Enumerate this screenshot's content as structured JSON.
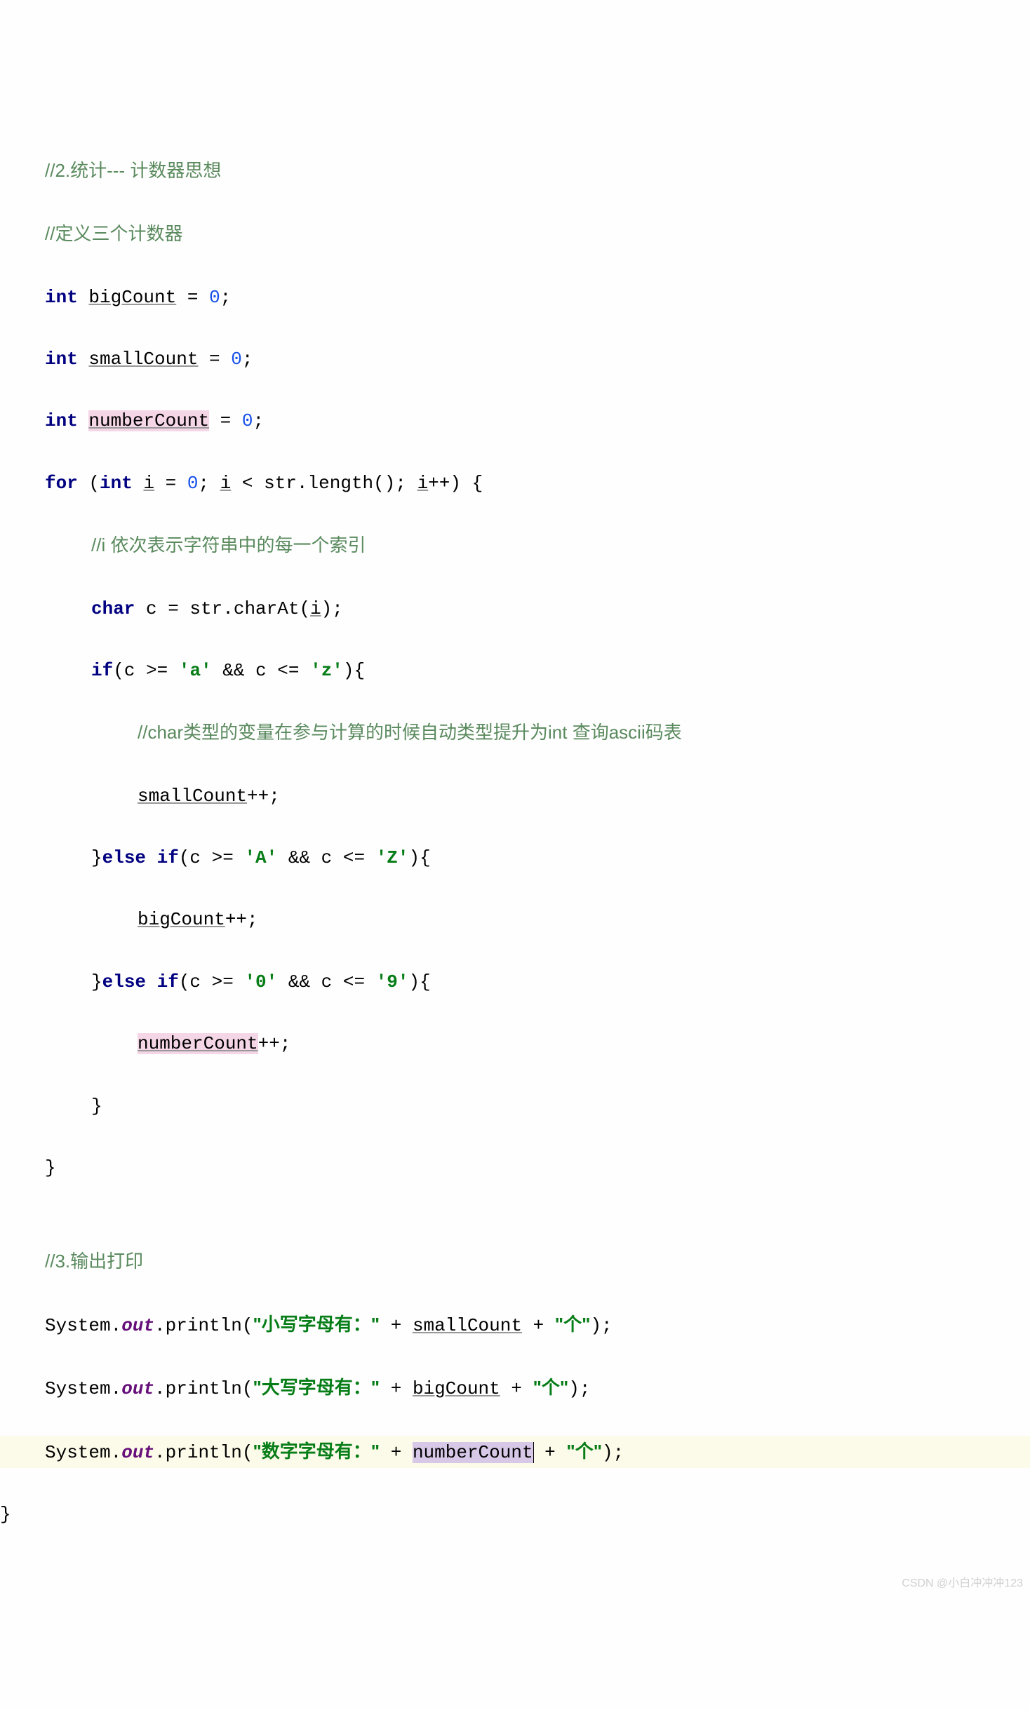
{
  "code": {
    "l1": {
      "c1": "//2.统计--- 计数器思想"
    },
    "l2": {
      "c1": "//定义三个计数器"
    },
    "l3": {
      "kw": "int",
      "var": "bigCount",
      "op": " = ",
      "num": "0",
      "semi": ";"
    },
    "l4": {
      "kw": "int",
      "var": "smallCount",
      "op": " = ",
      "num": "0",
      "semi": ";"
    },
    "l5": {
      "kw": "int",
      "var": "numberCount",
      "op": " = ",
      "num": "0",
      "semi": ";"
    },
    "l6": {
      "kw1": "for",
      "p1": " (",
      "kw2": "int",
      "v1": "i",
      "eq": " = ",
      "n1": "0",
      "s1": "; ",
      "v2": "i",
      "cmp": " < ",
      "obj": "str.length(); ",
      "v3": "i",
      "inc": "++) {"
    },
    "l7": {
      "c1": "//i 依次表示字符串中的每一个索引"
    },
    "l8": {
      "kw": "char",
      "txt1": " c = str.charAt(",
      "var": "i",
      "txt2": ");"
    },
    "l9": {
      "kw": "if",
      "p1": "(c >= ",
      "ch1": "'a'",
      "op1": " && c <= ",
      "ch2": "'z'",
      "p2": "){"
    },
    "l10": {
      "c1": "//char类型的变量在参与计算的时候自动类型提升为int 查询ascii码表"
    },
    "l11": {
      "var": "smallCount",
      "inc": "++;"
    },
    "l12": {
      "p1": "}",
      "kw": "else if",
      "p2": "(c >= ",
      "ch1": "'A'",
      "op1": " && c <= ",
      "ch2": "'Z'",
      "p3": "){"
    },
    "l13": {
      "var": "bigCount",
      "inc": "++;"
    },
    "l14": {
      "p1": "}",
      "kw": "else if",
      "p2": "(c >= ",
      "ch1": "'0'",
      "op1": " && c <= ",
      "ch2": "'9'",
      "p3": "){"
    },
    "l15": {
      "var": "numberCount",
      "inc": "++;"
    },
    "l16": {
      "brace": "}"
    },
    "l17": {
      "brace": "}"
    },
    "l18": {
      "blank": ""
    },
    "l19": {
      "c1": "//3.输出打印"
    },
    "l20": {
      "sys": "System.",
      "out": "out",
      "pr": ".println(",
      "str": "\"小写字母有：\"",
      "op1": " + ",
      "var": "smallCount",
      "op2": " + ",
      "str2": "\"个\"",
      "end": ");"
    },
    "l21": {
      "sys": "System.",
      "out": "out",
      "pr": ".println(",
      "str": "\"大写字母有：\"",
      "op1": " + ",
      "var": "bigCount",
      "op2": " + ",
      "str2": "\"个\"",
      "end": ");"
    },
    "l22": {
      "sys": "System.",
      "out": "out",
      "pr": ".println(",
      "str": "\"数字字母有：\"",
      "op1": " + ",
      "var": "numberCount",
      "op2": " + ",
      "str2": "\"个\"",
      "end": ");"
    },
    "l23": {
      "brace": "}"
    }
  },
  "watermark": "CSDN @小白冲冲冲123"
}
